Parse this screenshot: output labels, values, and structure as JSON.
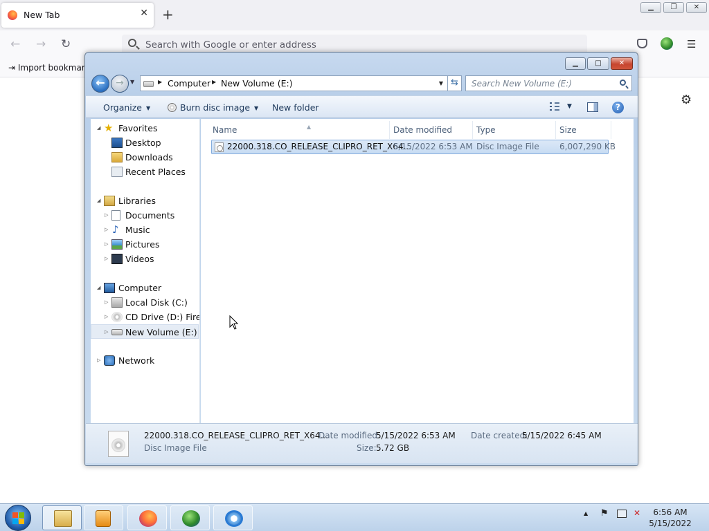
{
  "browser": {
    "tab_title": "New Tab",
    "url_placeholder": "Search with Google or enter address",
    "bookmark_label": "Import bookmarks...",
    "new_tab_symbol": "+",
    "close_tab_symbol": "✕"
  },
  "explorer": {
    "breadcrumb": [
      "Computer",
      "New Volume (E:)"
    ],
    "search_placeholder": "Search New Volume (E:)",
    "toolbar": {
      "organize": "Organize",
      "burn": "Burn disc image",
      "new_folder": "New folder"
    },
    "nav": {
      "favorites": "Favorites",
      "desktop": "Desktop",
      "downloads": "Downloads",
      "recent": "Recent Places",
      "libraries": "Libraries",
      "documents": "Documents",
      "music": "Music",
      "pictures": "Pictures",
      "videos": "Videos",
      "computer": "Computer",
      "local_disk": "Local Disk (C:)",
      "cd_drive": "CD Drive (D:) Firefox",
      "new_volume": "New Volume (E:)",
      "network": "Network"
    },
    "columns": {
      "name": "Name",
      "date": "Date modified",
      "type": "Type",
      "size": "Size"
    },
    "files": [
      {
        "name": "22000.318.CO_RELEASE_CLIPRO_RET_X64...",
        "date": "5/15/2022 6:53 AM",
        "type": "Disc Image File",
        "size": "6,007,290 KB"
      }
    ],
    "details": {
      "name": "22000.318.CO_RELEASE_CLIPRO_RET_X64...",
      "type": "Disc Image File",
      "date_modified_label": "Date modified:",
      "date_modified": "5/15/2022 6:53 AM",
      "date_created_label": "Date created:",
      "date_created": "5/15/2022 6:45 AM",
      "size_label": "Size:",
      "size": "5.72 GB"
    }
  },
  "taskbar": {
    "time": "6:56 AM",
    "date": "5/15/2022"
  }
}
